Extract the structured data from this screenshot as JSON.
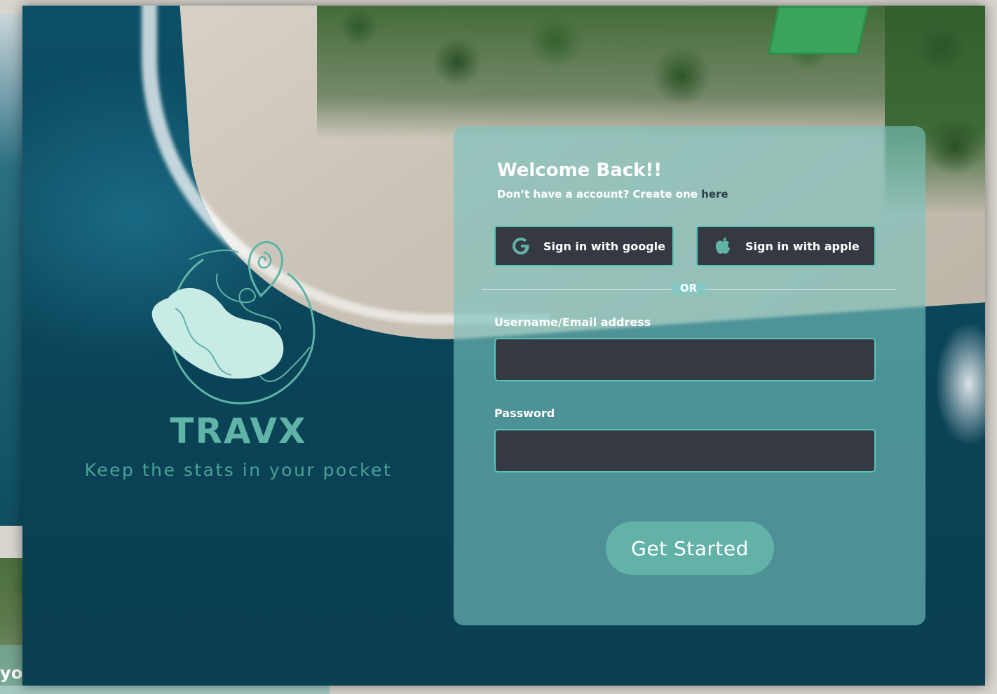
{
  "background_app": {
    "card_title": "your Trip!"
  },
  "brand": {
    "name": "TRAVX",
    "tagline": "Keep the stats in your pocket",
    "logo_icon": "globe-with-location-pin-icon"
  },
  "login": {
    "title": "Welcome Back!!",
    "signup_prompt": "Don’t have a account? Create one ",
    "signup_link": "here",
    "google_button": "Sign in with google",
    "apple_button": "Sign in with apple",
    "divider_text": "OR",
    "username_label": "Username/Email address",
    "username_value": "",
    "password_label": "Password",
    "password_value": "",
    "submit_button": "Get Started"
  },
  "colors": {
    "accent": "#5cc2b6",
    "button_primary": "#63b2a8",
    "input_bg": "#353a42",
    "brand_text": "#5fb3a7"
  }
}
